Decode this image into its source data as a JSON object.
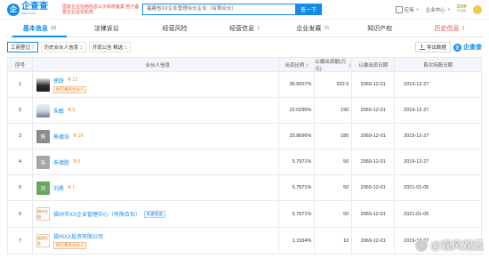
{
  "header": {
    "logo_text": "企查查",
    "logo_sub": "Qcc.com",
    "logo_mark": "企",
    "slogan": "国家企业信用信息公示系统备案 官方备案企业征信机构",
    "search_value": "福建省XX企业管理合伙企业（有限合伙）",
    "search_button": "查一下",
    "app_label": "应用",
    "center_label": "企业中心",
    "vip_label": "SVIP",
    "vip_sub": "专业版"
  },
  "tabs": [
    {
      "label": "基本信息",
      "count": "19"
    },
    {
      "label": "法律诉讼",
      "count": ""
    },
    {
      "label": "经营风险",
      "count": ""
    },
    {
      "label": "经营信息",
      "count": "2"
    },
    {
      "label": "企业发展",
      "count": "35"
    },
    {
      "label": "知识产权",
      "count": ""
    },
    {
      "label": "历史信息",
      "count": "1"
    }
  ],
  "subtabs": [
    {
      "label": "工商登记",
      "count": "7"
    },
    {
      "label": "历史合伙人信息",
      "count": "1"
    },
    {
      "label": "开庭公告 精选",
      "count": "1"
    }
  ],
  "toolbar": {
    "export_label": "导出数据",
    "brand": "企查查"
  },
  "table": {
    "headers": {
      "no": "序号",
      "name": "合伙人信息",
      "ratio": "出资比例",
      "amount": "认缴出资额(万元)",
      "date": "认缴出资日期",
      "first": "首次持股日期"
    },
    "rows": [
      {
        "no": "1",
        "avatar": "",
        "name": "徐跃",
        "rel": "12",
        "tag": "执行事务合伙人",
        "ratio": "36.5507%",
        "amount": "532.5",
        "date": "2069-12-01",
        "first": "2019-12-27"
      },
      {
        "no": "2",
        "avatar": "",
        "name": "朱敏",
        "rel": "3",
        "tag": "",
        "ratio": "22.0290%",
        "amount": "190",
        "date": "2069-12-01",
        "first": "2019-12-27"
      },
      {
        "no": "3",
        "avatar": "熊",
        "name": "熊德培",
        "rel": "19",
        "tag": "",
        "ratio": "20.8696%",
        "amount": "180",
        "date": "2069-12-01",
        "first": "2019-12-27"
      },
      {
        "no": "4",
        "avatar": "朱",
        "name": "朱德胜",
        "rel": "5",
        "tag": "",
        "ratio": "5.7971%",
        "amount": "50",
        "date": "2069-12-01",
        "first": "2019-12-27"
      },
      {
        "no": "5",
        "avatar": "刘",
        "name": "刘勇",
        "rel": "1",
        "tag": "",
        "ratio": "5.7971%",
        "amount": "50",
        "date": "2069-12-01",
        "first": "2021-01-05"
      },
      {
        "no": "6",
        "avatar": "福州金融",
        "name": "福州市XX企业管理中心（有限合伙）",
        "rel": "",
        "tag": "私募基金",
        "ratio": "5.7971%",
        "amount": "50",
        "date": "2069-12-01",
        "first": "2021-01-05"
      },
      {
        "no": "7",
        "avatar": "福建信息",
        "name": "福州XX投资有限公司",
        "rel": "",
        "tag": "执行事务合伙人",
        "ratio": "1.1594%",
        "amount": "10",
        "date": "2069-12-01",
        "first": "2019-12-27"
      }
    ]
  },
  "watermark": "@观风观景",
  "colors": {
    "accent": "#128bed",
    "alert": "#e54d42",
    "tag": "#e2852e"
  }
}
